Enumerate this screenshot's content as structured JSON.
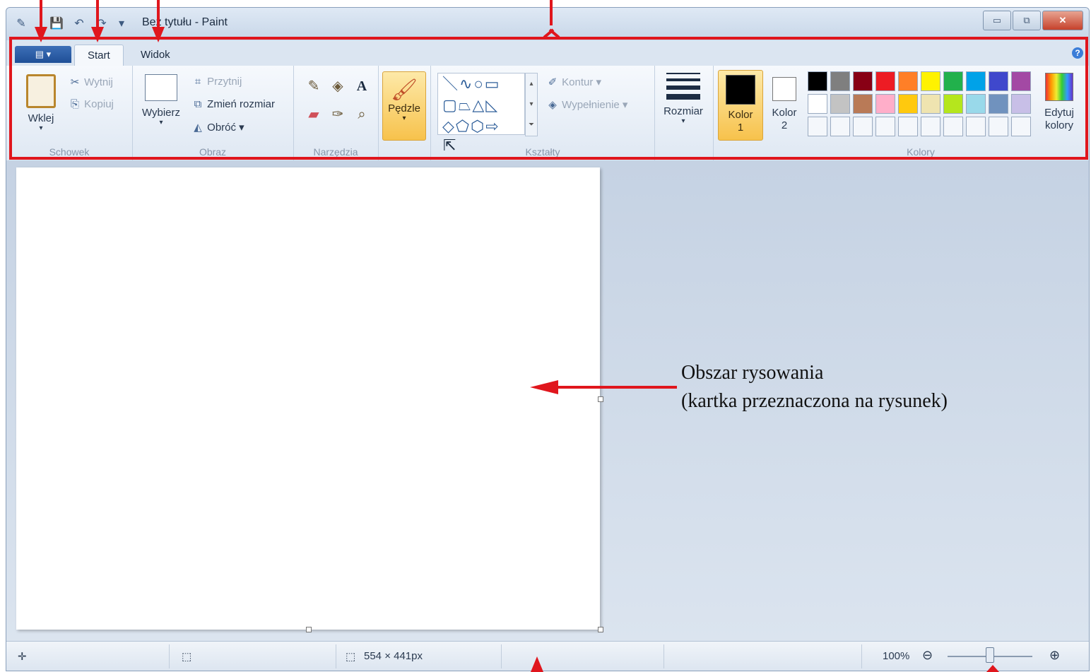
{
  "window": {
    "title": "Bez tytułu - Paint",
    "buttons": {
      "minimize": "▭",
      "maximize": "⧉",
      "close": "✕"
    }
  },
  "quick_access": {
    "icons": [
      "paint-app-icon",
      "save-icon",
      "undo-icon",
      "redo-icon",
      "customize-dropdown-icon"
    ]
  },
  "tabs": {
    "file": "▤ ▾",
    "start": "Start",
    "view": "Widok"
  },
  "ribbon": {
    "clipboard": {
      "paste": "Wklej",
      "cut": "Wytnij",
      "copy": "Kopiuj",
      "label": "Schowek"
    },
    "image": {
      "select": "Wybierz",
      "crop": "Przytnij",
      "resize": "Zmień rozmiar",
      "rotate": "Obróć ▾",
      "label": "Obraz"
    },
    "tools": {
      "label": "Narzędzia",
      "text_tool": "A"
    },
    "brushes": {
      "label": "Pędzle"
    },
    "shapes": {
      "outline": "Kontur ▾",
      "fill": "Wypełnienie ▾",
      "label": "Kształty"
    },
    "size": {
      "label": "Rozmiar"
    },
    "colors": {
      "color1": "Kolor 1",
      "color2": "Kolor 2",
      "edit": "Edytuj kolory",
      "label": "Kolory",
      "palette": [
        "#000000",
        "#7f7f7f",
        "#880015",
        "#ed1c24",
        "#ff7f27",
        "#fff200",
        "#22b14c",
        "#00a2e8",
        "#3f48cc",
        "#a349a4",
        "#ffffff",
        "#c3c3c3",
        "#b97a57",
        "#ffaec9",
        "#ffc90e",
        "#efe4b0",
        "#b5e61d",
        "#99d9ea",
        "#7092be",
        "#c8bfe7",
        "#f4f7fb",
        "#f4f7fb",
        "#f4f7fb",
        "#f4f7fb",
        "#f4f7fb",
        "#f4f7fb",
        "#f4f7fb",
        "#f4f7fb",
        "#f4f7fb",
        "#f4f7fb"
      ]
    }
  },
  "statusbar": {
    "image_size": "554 × 441px",
    "zoom": "100%"
  },
  "annotation": {
    "line1": "Obszar rysowania",
    "line2": "(kartka przeznaczona na rysunek)",
    "color": "#e0161d"
  }
}
